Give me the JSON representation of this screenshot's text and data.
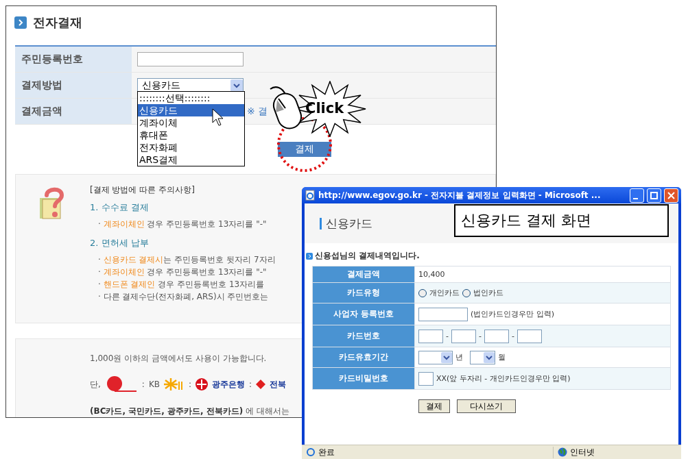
{
  "page": {
    "title": "전자결재",
    "form": [
      {
        "label": "주민등록번호",
        "kind": "input"
      },
      {
        "label": "결제방법",
        "kind": "select",
        "value": "신용카드"
      },
      {
        "label": "결제금액",
        "kind": "note",
        "note": "※ 결"
      }
    ],
    "dropdown": [
      {
        "label": "::::::::선택::::::::",
        "selected": false
      },
      {
        "label": "신용카드",
        "selected": true
      },
      {
        "label": "계좌이체",
        "selected": false
      },
      {
        "label": "휴대폰",
        "selected": false
      },
      {
        "label": "전자화폐",
        "selected": false
      },
      {
        "label": "ARS결제",
        "selected": false
      }
    ],
    "submit_button": "결제",
    "notice": {
      "heading": "[결제 방법에 따른 주의사항]",
      "sections": [
        {
          "title": "1. 수수료 결제",
          "items": [
            {
              "bullet": "·",
              "highlight": "계좌이체인",
              "rest": " 경우 주민등록번호 13자리를 \"-\""
            }
          ]
        },
        {
          "title": "2. 면허세 납부",
          "items": [
            {
              "bullet": "·",
              "highlight": "신용카드 결제시",
              "rest": "는 주민등록번호 뒷자리 7자리"
            },
            {
              "bullet": "·",
              "highlight": "계좌이체인",
              "rest": " 경우 주민등록번호 13자리를 \"-\""
            },
            {
              "bullet": "·",
              "highlight": "핸드폰 결제인",
              "rest": " 경우 주민등록번호 13자리를"
            },
            {
              "bullet": "·",
              "rest": "다른 결제수단(전자화폐, ARS)시 주민번호는"
            }
          ]
        }
      ]
    },
    "cards": {
      "line": "1,000원 이하의 금액에서도 사용이 가능합니다.",
      "prefix": "단,",
      "logos": [
        {
          "kind": "ball"
        },
        {
          "kind": "sep",
          "text": ":"
        },
        {
          "kind": "star",
          "text": "KB"
        },
        {
          "kind": "sep",
          "text": ":"
        },
        {
          "kind": "cross",
          "text": "광주은행"
        },
        {
          "kind": "sep",
          "text": ":"
        },
        {
          "kind": "diamond",
          "text": "전북"
        }
      ],
      "footer": "**(BC카드, 국민카드, 광주카드, 전북카드)** 에 대해서는"
    }
  },
  "annotation": {
    "click": "Click",
    "callout": "신용카드 결제 화면"
  },
  "popup": {
    "title": "http://www.egov.go.kr - 전자지불 결제정보 입력화면 - Microsoft ...",
    "header": "신용카드",
    "subheading": "신용섭님의 결제내역입니다.",
    "rows": [
      {
        "label": "결제금액",
        "kind": "text",
        "value": "10,400"
      },
      {
        "label": "카드유형",
        "kind": "radio",
        "options": [
          {
            "label": "개인카드",
            "selected": false
          },
          {
            "label": "법인카드",
            "selected": false
          }
        ]
      },
      {
        "label": "사업자 등록번호",
        "kind": "input_note",
        "note": "(법인카드인경우만 입력)"
      },
      {
        "label": "카드번호",
        "kind": "card_number",
        "separators": [
          "-",
          "-",
          "-"
        ]
      },
      {
        "label": "카드유효기간",
        "kind": "expiry",
        "units": [
          "년",
          "월"
        ]
      },
      {
        "label": "카드비밀번호",
        "kind": "password_note",
        "note": "XX(앞 두자리 - 개인카드인경우만 입력)"
      }
    ],
    "buttons": [
      "결제",
      "다시쓰기"
    ],
    "status": {
      "text": "완료",
      "zone": "인터넷"
    }
  }
}
